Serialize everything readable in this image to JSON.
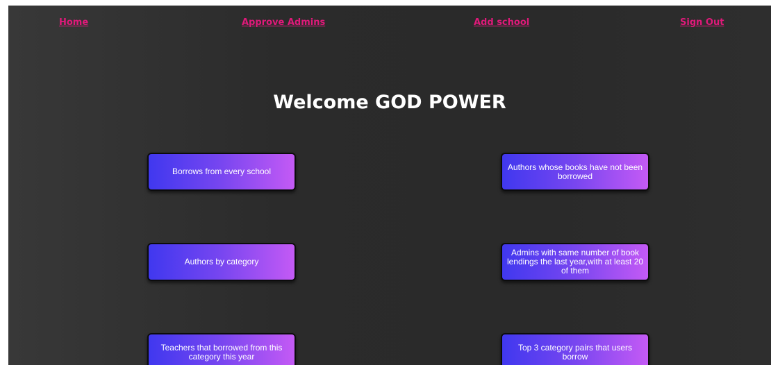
{
  "nav": {
    "home": "Home",
    "approve_admins": "Approve Admins",
    "add_school": "Add school",
    "sign_out": "Sign Out"
  },
  "welcome_title": "Welcome GOD POWER",
  "query_buttons": [
    "Borrows from every school",
    "Authors whose books have not been borrowed",
    "Authors by category",
    "Admins with same number of book lendings the last year,with at least 20 of them",
    "Teachers that borrowed from this category this year",
    "Top 3 category pairs that users borrow"
  ],
  "colors": {
    "nav_link": "#e0197a",
    "button_gradient_start": "#4038ef",
    "button_gradient_end": "#c45af5",
    "background": "#2a2a2a"
  }
}
